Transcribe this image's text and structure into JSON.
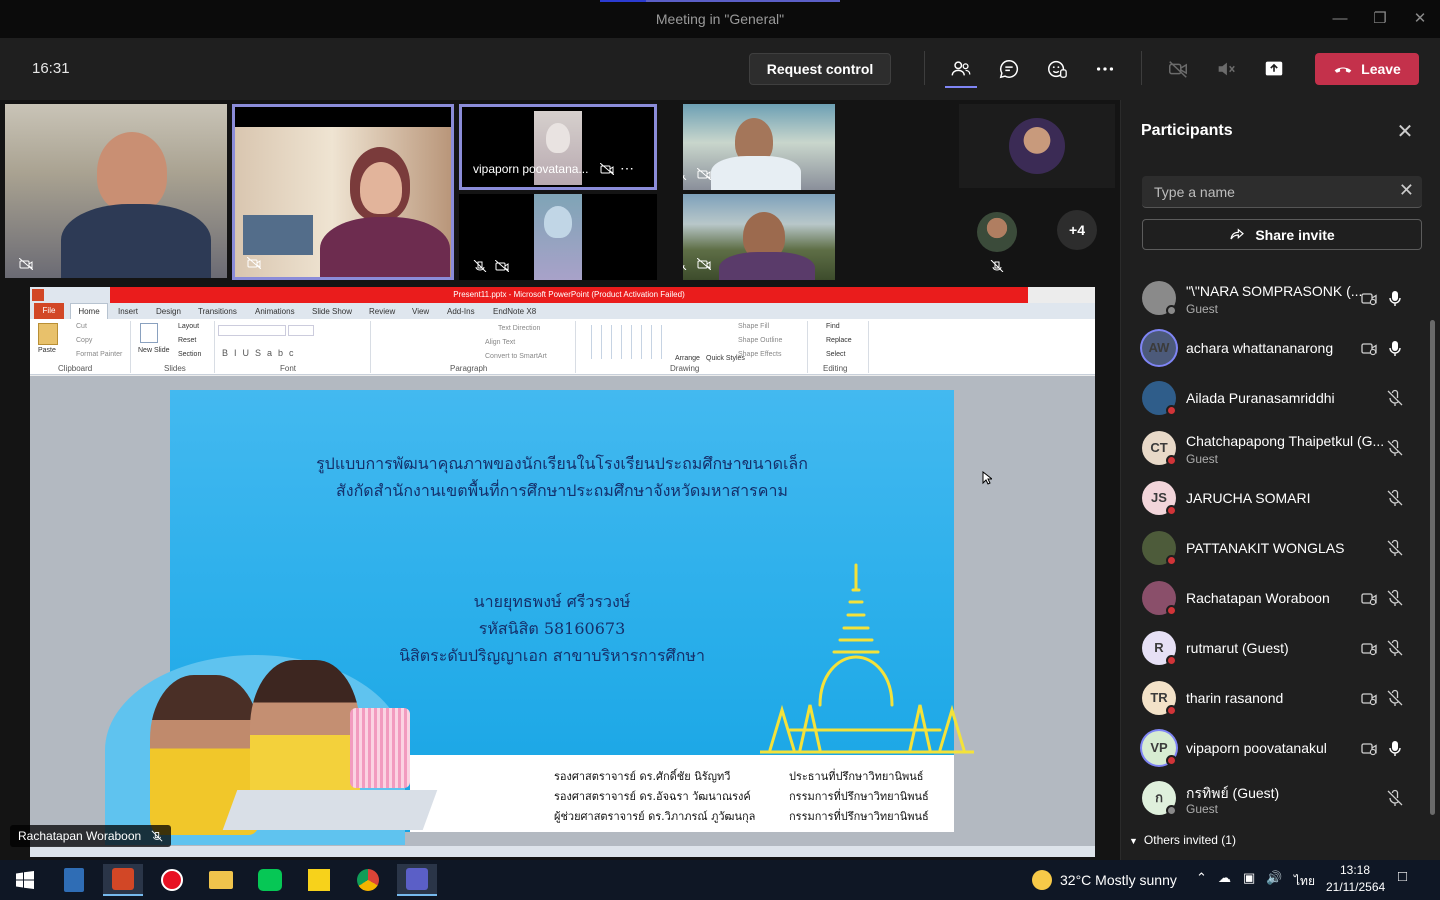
{
  "window": {
    "title": "Meeting in \"General\""
  },
  "toolbar": {
    "clock": "16:31",
    "request_control": "Request control",
    "leave": "Leave"
  },
  "tiles": [
    {
      "name": ""
    },
    {
      "name": ""
    },
    {
      "name": "vipaporn poovatana..."
    },
    {
      "name": ""
    },
    {
      "name": ""
    },
    {
      "name": ""
    }
  ],
  "overflow": {
    "more_count": "+4"
  },
  "presenter_label": "Rachatapan Woraboon",
  "powerpoint": {
    "title": "Present11.pptx - Microsoft PowerPoint (Product Activation Failed)",
    "tabs": [
      "File",
      "Home",
      "Insert",
      "Design",
      "Transitions",
      "Animations",
      "Slide Show",
      "Review",
      "View",
      "Add-Ins",
      "EndNote X8"
    ],
    "groups": [
      "Clipboard",
      "Slides",
      "Font",
      "Paragraph",
      "Drawing",
      "Editing"
    ],
    "commands": {
      "paste": "Paste",
      "cut": "Cut",
      "copy": "Copy",
      "format_painter": "Format Painter",
      "new_slide": "New Slide",
      "layout": "Layout",
      "reset": "Reset",
      "section": "Section",
      "arrange": "Arrange",
      "quick_styles": "Quick Styles",
      "shape_fill": "Shape Fill",
      "shape_outline": "Shape Outline",
      "shape_effects": "Shape Effects",
      "find": "Find",
      "replace": "Replace",
      "select": "Select",
      "text_direction": "Text Direction",
      "align_text": "Align Text",
      "convert_smartart": "Convert to SmartArt"
    }
  },
  "slide": {
    "title_line1": "รูปแบบการพัฒนาคุณภาพของนักเรียนในโรงเรียนประถมศึกษาขนาดเล็ก",
    "title_line2": "สังกัดสำนักงานเขตพื้นที่การศึกษาประถมศึกษาจังหวัดมหาสารคาม",
    "author": "นายยุทธพงษ์ ศรีวรวงษ์",
    "student_id": "รหัสนิสิต 58160673",
    "program": "นิสิตระดับปริญญาเอก สาขาบริหารการศึกษา",
    "advisors": [
      {
        "name": "รองศาสตราจารย์ ดร.ศักดิ์ชัย นิรัญทวี",
        "role": "ประธานที่ปรึกษาวิทยานิพนธ์"
      },
      {
        "name": "รองศาสตราจารย์ ดร.อัจฉรา วัฒนาณรงค์",
        "role": "กรรมการที่ปรึกษาวิทยานิพนธ์"
      },
      {
        "name": "ผู้ช่วยศาสตราจารย์ ดร.วิภาภรณ์ ภูวัฒนกุล",
        "role": "กรรมการที่ปรึกษาวิทยานิพนธ์"
      }
    ]
  },
  "panel": {
    "title": "Participants",
    "search_placeholder": "Type a name",
    "share_invite": "Share invite",
    "participants": [
      {
        "name": "\"\\\"NARA SOMPRASONK (...",
        "sub": "Guest",
        "initials": "",
        "color": "#8a8a8a",
        "status": "#8a8a8a",
        "cam": true,
        "mic": "on"
      },
      {
        "name": "achara whattananarong",
        "sub": "",
        "initials": "AW",
        "color": "#4c5a7a",
        "status": "",
        "cam": true,
        "mic": "on"
      },
      {
        "name": "Ailada Puranasamriddhi",
        "sub": "",
        "initials": "",
        "color": "#2f5d8a",
        "status": "#d13438",
        "cam": false,
        "mic": "off"
      },
      {
        "name": "Chatchapapong Thaipetkul (G...",
        "sub": "Guest",
        "initials": "CT",
        "color": "#e8d9c8",
        "status": "#d13438",
        "cam": false,
        "mic": "off"
      },
      {
        "name": "JARUCHA SOMARI",
        "sub": "",
        "initials": "JS",
        "color": "#f2d5da",
        "status": "#d13438",
        "cam": false,
        "mic": "off"
      },
      {
        "name": "PATTANAKIT WONGLAS",
        "sub": "",
        "initials": "",
        "color": "#4d5b3a",
        "status": "#d13438",
        "cam": false,
        "mic": "off"
      },
      {
        "name": "Rachatapan Woraboon",
        "sub": "",
        "initials": "",
        "color": "#8a4f6a",
        "status": "#d13438",
        "cam": true,
        "mic": "off"
      },
      {
        "name": "rutmarut (Guest)",
        "sub": "",
        "initials": "R",
        "color": "#e6e0f5",
        "status": "#d13438",
        "cam": true,
        "mic": "off"
      },
      {
        "name": "tharin rasanond",
        "sub": "",
        "initials": "TR",
        "color": "#f3e2c8",
        "status": "#d13438",
        "cam": true,
        "mic": "off"
      },
      {
        "name": "vipaporn poovatanakul",
        "sub": "",
        "initials": "VP",
        "color": "#d7ecd2",
        "status": "#d13438",
        "cam": true,
        "mic": "on"
      },
      {
        "name": "กรทิพย์ (Guest)",
        "sub": "Guest",
        "initials": "ก",
        "color": "#dff0dc",
        "status": "#8a8a8a",
        "cam": false,
        "mic": "off"
      }
    ],
    "others_invited": "Others invited (1)"
  },
  "taskbar": {
    "weather": "32°C  Mostly sunny",
    "lang": "ไทย",
    "time": "13:18",
    "date": "21/11/2564"
  },
  "colors": {
    "leave": "#c4314b",
    "accent": "#7f85f5",
    "slide_blue": "#29aeea"
  }
}
